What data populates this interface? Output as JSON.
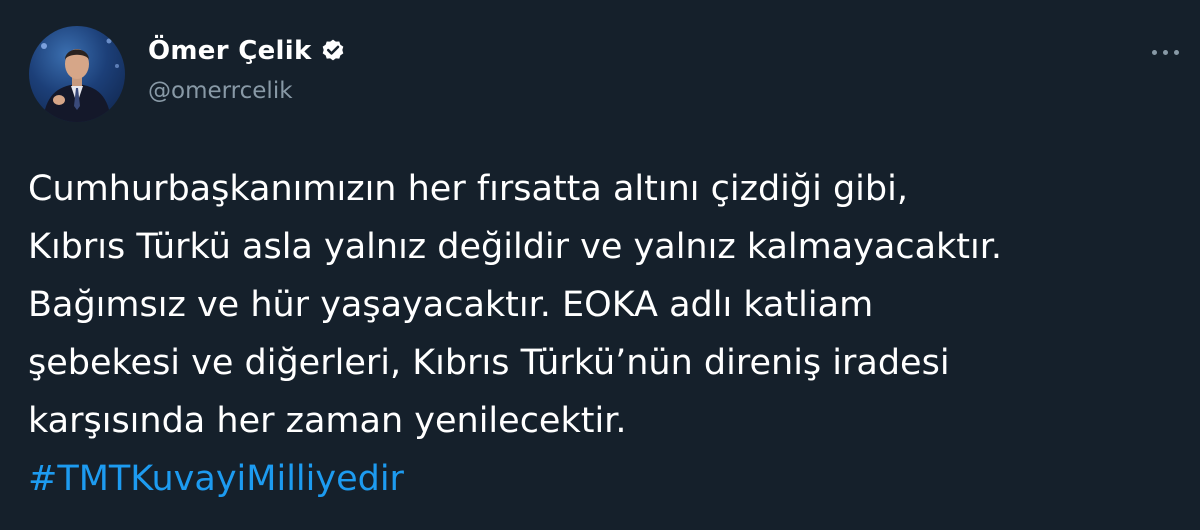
{
  "author": {
    "display_name": "Ömer Çelik",
    "handle": "@omerrcelik",
    "verified": true
  },
  "tweet": {
    "lines": [
      "Cumhurbaşkanımızın her fırsatta altını çizdiği gibi,",
      "Kıbrıs Türkü asla yalnız değildir ve yalnız kalmayacaktır.",
      "Bağımsız ve hür yaşayacaktır. EOKA adlı katliam",
      "şebekesi ve diğerleri, Kıbrıs Türkü’nün direniş iradesi",
      "karşısında her zaman yenilecektir."
    ],
    "hashtag": "#TMTKuvayiMilliyedir"
  },
  "icons": {
    "verified": "verified-badge-icon",
    "more": "more-options-icon"
  },
  "colors": {
    "background": "#15202b",
    "text": "#ffffff",
    "secondary": "#8899a6",
    "link": "#1d9bf0"
  }
}
